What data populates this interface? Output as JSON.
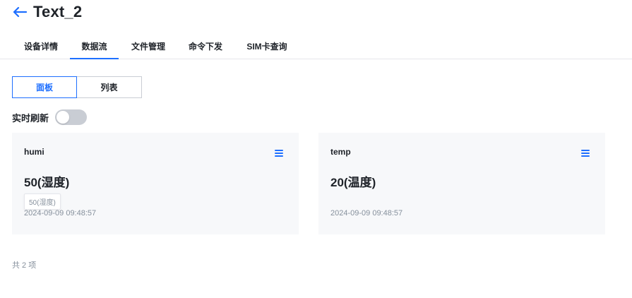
{
  "header": {
    "back_icon": "arrow-left-icon",
    "title": "Text_2"
  },
  "tabs": [
    {
      "label": "设备详情",
      "active": false
    },
    {
      "label": "数据流",
      "active": true
    },
    {
      "label": "文件管理",
      "active": false
    },
    {
      "label": "命令下发",
      "active": false
    },
    {
      "label": "SIM卡查询",
      "active": false
    }
  ],
  "view_toggle": {
    "options": [
      {
        "label": "面板",
        "active": true
      },
      {
        "label": "列表",
        "active": false
      }
    ]
  },
  "realtime_refresh": {
    "label": "实时刷新",
    "enabled": false
  },
  "cards": [
    {
      "name": "humi",
      "value": "50(湿度)",
      "tooltip": "50(湿度)",
      "timestamp": "2024-09-09 09:48:57",
      "menu_icon": "menu-icon"
    },
    {
      "name": "temp",
      "value": "20(温度)",
      "timestamp": "2024-09-09 09:48:57",
      "menu_icon": "menu-icon"
    }
  ],
  "footer": {
    "total": "共 2 项"
  },
  "colors": {
    "accent": "#1e6fff",
    "card_bg": "#f7f8fa",
    "muted_text": "#86909c",
    "switch_off": "#c9cdd4"
  }
}
